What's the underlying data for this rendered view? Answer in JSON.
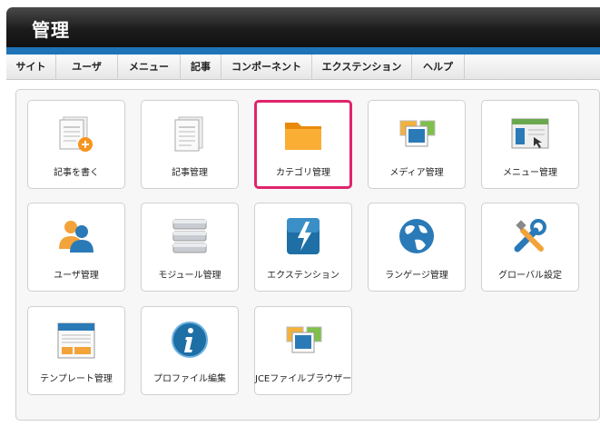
{
  "header": {
    "title": "管理"
  },
  "menu": [
    {
      "label": "サイト"
    },
    {
      "label": "ユーザ"
    },
    {
      "label": "メニュー"
    },
    {
      "label": "記事"
    },
    {
      "label": "コンポーネント"
    },
    {
      "label": "エクステンション"
    },
    {
      "label": "ヘルプ"
    }
  ],
  "tiles": [
    {
      "label": "記事を書く",
      "icon": "new-article-icon"
    },
    {
      "label": "記事管理",
      "icon": "article-icon"
    },
    {
      "label": "カテゴリ管理",
      "icon": "folder-icon",
      "selected": true
    },
    {
      "label": "メディア管理",
      "icon": "media-icon"
    },
    {
      "label": "メニュー管理",
      "icon": "menu-manager-icon"
    },
    {
      "label": "ユーザ管理",
      "icon": "users-icon"
    },
    {
      "label": "モジュール管理",
      "icon": "modules-icon"
    },
    {
      "label": "エクステンション",
      "icon": "extension-icon"
    },
    {
      "label": "ランゲージ管理",
      "icon": "globe-icon"
    },
    {
      "label": "グローバル設定",
      "icon": "tools-icon"
    },
    {
      "label": "テンプレート管理",
      "icon": "template-icon"
    },
    {
      "label": "プロファイル編集",
      "icon": "info-icon"
    },
    {
      "label": "JCEファイルブラウザー",
      "icon": "file-browser-icon"
    }
  ],
  "colors": {
    "accent": "#1f73b7",
    "selected_border": "#e0246c"
  }
}
